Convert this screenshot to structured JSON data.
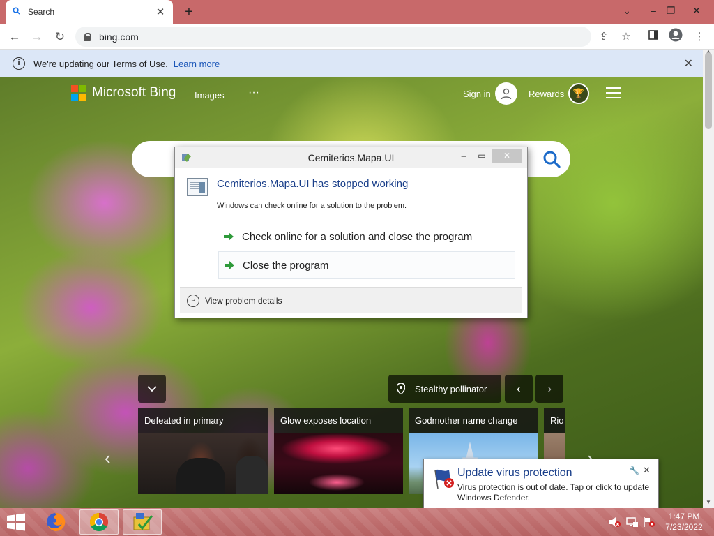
{
  "browser": {
    "tab_title": "Search",
    "url": "bing.com"
  },
  "infobar": {
    "message": "We're updating our Terms of Use.",
    "link": "Learn more"
  },
  "bing": {
    "logo_text": "Microsoft Bing",
    "nav_images": "Images",
    "nav_more": "···",
    "sign_in": "Sign in",
    "rewards": "Rewards",
    "image_title": "Stealthy pollinator",
    "news": [
      {
        "title": "Defeated in primary"
      },
      {
        "title": "Glow exposes location"
      },
      {
        "title": "Godmother name change"
      },
      {
        "title": "Rio"
      }
    ]
  },
  "dialog": {
    "title": "Cemiterios.Mapa.UI",
    "heading": "Cemiterios.Mapa.UI has stopped working",
    "subtext": "Windows can check online for a solution to the problem.",
    "option1": "Check online for a solution and close the program",
    "option2": "Close the program",
    "details": "View problem details"
  },
  "notification": {
    "title": "Update virus protection",
    "text": "Virus protection is out of date. Tap or click to update Windows Defender."
  },
  "taskbar": {
    "time": "1:47 PM",
    "date": "7/23/2022",
    "apps": [
      "firefox",
      "chrome",
      "installer"
    ]
  },
  "colors": {
    "tabstrip": "#c8696a",
    "infobar": "#dce7f7",
    "link_blue": "#1a56b8",
    "dialog_heading": "#1a3f8a",
    "ms_red": "#f25022",
    "ms_green": "#7fba00",
    "ms_blue": "#00a4ef",
    "ms_yellow": "#ffb900"
  }
}
